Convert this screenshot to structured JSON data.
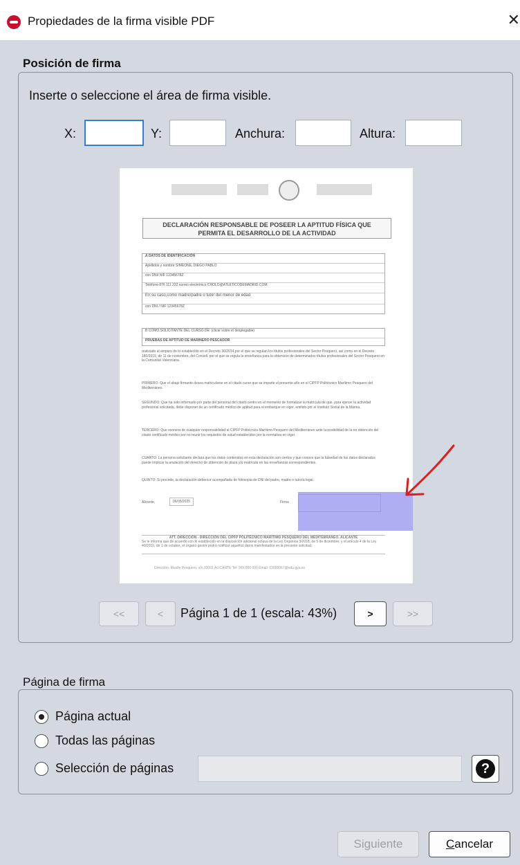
{
  "window": {
    "title": "Propiedades de la firma visible PDF",
    "close_glyph": "✕",
    "icon": "app-logo-icon"
  },
  "position_section": {
    "label": "Posición de firma",
    "instructions": "Inserte o seleccione el área de firma visible.",
    "fields": {
      "x_label": "X:",
      "x_value": "",
      "y_label": "Y:",
      "y_value": "",
      "width_label": "Anchura:",
      "width_value": "",
      "height_label": "Altura:",
      "height_value": ""
    }
  },
  "preview": {
    "heading_line1": "DECLARACIÓN RESPONSABLE DE POSEER LA APTITUD FÍSICA QUE",
    "heading_line2": "PERMITA EL DESARROLLO DE LA ACTIVIDAD",
    "section_a": "A    DATOS DE IDENTIFICACIÓN",
    "rows_a": [
      "Apellidos y nombre   SIMEONE, DIEGO PABLO",
      "con DNI/ NIF   12345678Z",
      "Teléfono   876 111 222          correo electrónico   CHOLO@ATLETICODEMADRID.COM",
      "En su caso,como madre/padre o tutor del menor de edad",
      "con DNI / NIF   12345678Z"
    ],
    "section_b": "B    COMO SOLICITANTE  DEL CURSO DE:             (clicar sobre el desplegable)",
    "course": "PRUEBAS DE APTITUD DE MARINERO PESCADOR",
    "paragraphs": [
      "realizado al amparo de lo establecido en el Decreto 36/2014 por el que se regulan los títulos profesionales del Sector Pesquero, así como en el Decreto 180/2015, de 11 de noviembre, del Consell, por el que se regula la enseñanza para la obtención de determinados títulos profesionales del Sector Pesquero en la Comunitat Valenciana.",
      "PRIMERO: Que el abajo firmante desea matricularse en el citado curso que se imparte el presente año en el CIPFP Politécnico Marítimo Pesquero del Mediterráneo.",
      "SEGUNDO: Que ha sido informado por parte del personal del citado centro en el momento de formalizar la matrícula de que, para ejercer la actividad profesional solicitada, debe disponer de un certificado médico de aptitud para el embarque en vigor, emitido por el Instituto Social de la Marina.",
      "TERCERO: Que exonera de cualquier responsabilidad al CIPFP Politécnico Marítimo Pesquero del Mediterráneo ante la posibilidad de la no obtención del citado certificado médico por no reunir los requisitos de salud establecidos por la normativa en vigor.",
      "CUARTO: La persona solicitante declara que los datos contenidos en esta declaración son ciertos y que conoce que la falsedad de los datos declarados puede implicar la anulación del derecho de obtención de plaza y/o matrícula en las enseñanzas correspondientes.",
      "QUINTO: Si procede, la declaración deberá ir acompañada de fotocopia de DNI del padre, madre o tutoría legal."
    ],
    "place_label": "Alicante,",
    "date": "06/05/2025",
    "sign_label": "Firma",
    "footer_title": "ATT. DIRECCIÓN - DIRECCIÓN DEL CIPFP POLITÉCNICO MARÍTIMO PESQUERO DEL MEDITERRÁNEO. ALICANTE",
    "footer_text": "Se le informa que de acuerdo con lo establecido en la disposición adicional octava de la Ley Orgánica 3/2018, de 5 de diciembre, y el artículo 4 de la Ley 40/2015, de 1 de octubre, el órgano gestor podrá notificar aquellos datos manifestados en la presente solicitud.",
    "address": "Dirección: Muelle Pesquero, s/n 03001 ALICANTE Tel: 965 000 000 Email: 03000067@edu.gva.es",
    "selection_color": "#aeaef5",
    "arrow_color": "#e21b1b"
  },
  "navigation": {
    "first": "<<",
    "prev": "<",
    "page_info": "Página 1 de 1 (escala: 43%)",
    "next": ">",
    "last": ">>"
  },
  "page_section": {
    "label": "Página de firma",
    "options": [
      {
        "label": "Página actual",
        "checked": true
      },
      {
        "label": "Todas las páginas",
        "checked": false
      },
      {
        "label": "Selección de páginas",
        "checked": false
      }
    ],
    "pages_value": "",
    "help_glyph": "?"
  },
  "footer_buttons": {
    "next_label": "Siguiente",
    "cancel_mnemonic": "C",
    "cancel_rest": "ancelar"
  }
}
